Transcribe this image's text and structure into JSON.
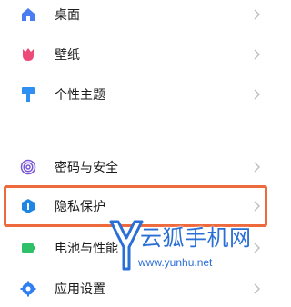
{
  "menu": {
    "items": [
      {
        "label": "桌面",
        "icon": "home-icon",
        "color": "#4a7cf2"
      },
      {
        "label": "壁纸",
        "icon": "tulip-icon",
        "color": "#ec4a78"
      },
      {
        "label": "个性主题",
        "icon": "paint-roller-icon",
        "color": "#2f8ff2"
      },
      {
        "label": "密码与安全",
        "icon": "fingerprint-icon",
        "color": "#7a57d8"
      },
      {
        "label": "隐私保护",
        "icon": "privacy-shield-icon",
        "color": "#1e86e5"
      },
      {
        "label": "电池与性能",
        "icon": "battery-icon",
        "color": "#2ec16a"
      },
      {
        "label": "应用设置",
        "icon": "gear-icon",
        "color": "#2f7ff2"
      }
    ]
  },
  "highlight": {
    "color": "#ee6a3d",
    "item": "隐私保护"
  },
  "watermark": {
    "title": "云狐手机网",
    "url": "www.yunhu.net",
    "color": "#2a6fd6"
  }
}
